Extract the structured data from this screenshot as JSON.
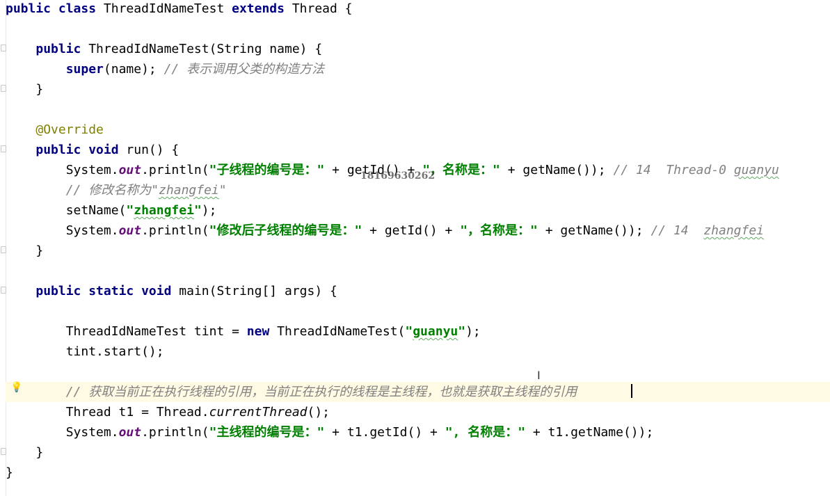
{
  "lines": [
    {
      "segs": [
        [
          "kw",
          "public class "
        ],
        [
          "",
          "ThreadIdNameTest "
        ],
        [
          "kw",
          "extends "
        ],
        [
          "",
          "Thread {"
        ]
      ]
    },
    {
      "segs": []
    },
    {
      "segs": [
        [
          "",
          "    "
        ],
        [
          "kw",
          "public "
        ],
        [
          "",
          "ThreadIdNameTest(String name) {"
        ]
      ]
    },
    {
      "segs": [
        [
          "",
          "        "
        ],
        [
          "kw",
          "super"
        ],
        [
          "",
          "(name); "
        ],
        [
          "cmt",
          "// 表示调用父类的构造方法"
        ]
      ]
    },
    {
      "segs": [
        [
          "",
          "    }"
        ]
      ]
    },
    {
      "segs": []
    },
    {
      "segs": [
        [
          "",
          "    "
        ],
        [
          "ann",
          "@Override"
        ]
      ]
    },
    {
      "segs": [
        [
          "",
          "    "
        ],
        [
          "kw",
          "public void "
        ],
        [
          "",
          "run() {"
        ]
      ]
    },
    {
      "segs": [
        [
          "",
          "        System."
        ],
        [
          "fld",
          "out"
        ],
        [
          "",
          ".println("
        ],
        [
          "str",
          "\"子线程的编号是：\""
        ],
        [
          "",
          " + getId() + "
        ],
        [
          "str",
          "\"，名称是：\""
        ],
        [
          "",
          " + getName()); "
        ],
        [
          "cmt",
          "// 14  Thread-0 "
        ],
        [
          "cmt typo",
          "guanyu"
        ]
      ]
    },
    {
      "segs": [
        [
          "",
          "        "
        ],
        [
          "cmt",
          "// 修改名称为\""
        ],
        [
          "cmt typo",
          "zhangfei"
        ],
        [
          "cmt",
          "\""
        ]
      ]
    },
    {
      "segs": [
        [
          "",
          "        setName("
        ],
        [
          "str",
          "\""
        ],
        [
          "str typo",
          "zhangfei"
        ],
        [
          "str",
          "\""
        ],
        [
          "",
          ");"
        ]
      ]
    },
    {
      "segs": [
        [
          "",
          "        System."
        ],
        [
          "fld",
          "out"
        ],
        [
          "",
          ".println("
        ],
        [
          "str",
          "\"修改后子线程的编号是：\""
        ],
        [
          "",
          " + getId() + "
        ],
        [
          "str",
          "\"，名称是：\""
        ],
        [
          "",
          " + getName()); "
        ],
        [
          "cmt",
          "// 14  "
        ],
        [
          "cmt typo",
          "zhangfei"
        ]
      ]
    },
    {
      "segs": [
        [
          "",
          "    }"
        ]
      ]
    },
    {
      "segs": []
    },
    {
      "segs": [
        [
          "",
          "    "
        ],
        [
          "kw",
          "public static void "
        ],
        [
          "",
          "main(String[] args) {"
        ]
      ]
    },
    {
      "segs": []
    },
    {
      "segs": [
        [
          "",
          "        ThreadIdNameTest tint = "
        ],
        [
          "kw",
          "new "
        ],
        [
          "",
          "ThreadIdNameTest("
        ],
        [
          "str",
          "\""
        ],
        [
          "str typo",
          "guanyu"
        ],
        [
          "str",
          "\""
        ],
        [
          "",
          ");"
        ]
      ]
    },
    {
      "segs": [
        [
          "",
          "        tint.start();"
        ]
      ]
    },
    {
      "segs": []
    },
    {
      "segs": [
        [
          "",
          "        "
        ],
        [
          "cmt",
          "// 获取当前正在执行线程的引用，当前正在执行的线程是主线程，也就是获取主线程的引用"
        ]
      ],
      "current": true
    },
    {
      "segs": [
        [
          "",
          "        Thread t1 = Thread."
        ],
        [
          "static-call",
          "currentThread"
        ],
        [
          "",
          "();"
        ]
      ]
    },
    {
      "segs": [
        [
          "",
          "        System."
        ],
        [
          "fld",
          "out"
        ],
        [
          "",
          ".println("
        ],
        [
          "str",
          "\"主线程的编号是：\""
        ],
        [
          "",
          " + t1.getId() + "
        ],
        [
          "str",
          "\", 名称是：\""
        ],
        [
          "",
          " + t1.getName());"
        ]
      ]
    },
    {
      "segs": [
        [
          "",
          "    }"
        ]
      ]
    },
    {
      "segs": [
        [
          "",
          "}"
        ]
      ]
    }
  ],
  "watermark": "18169630262",
  "icons": {
    "intention": "lightbulb-icon",
    "cursor": "text-cursor-icon"
  }
}
